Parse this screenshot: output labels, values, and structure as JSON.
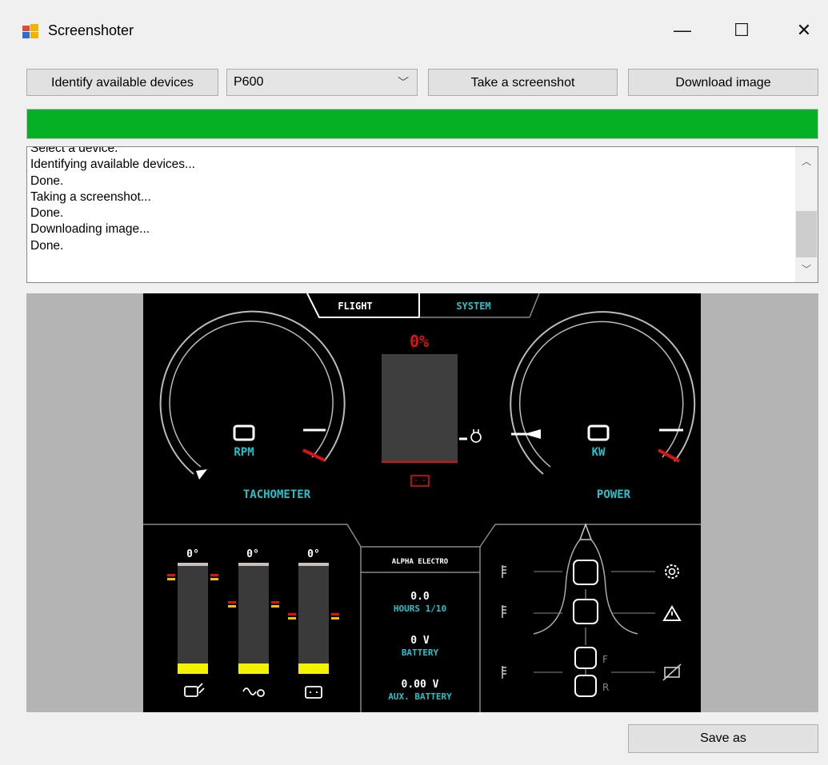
{
  "window": {
    "title": "Screenshoter",
    "minimize_glyph": "—",
    "maximize_glyph": "☐",
    "close_glyph": "✕"
  },
  "toolbar": {
    "identify_label": "Identify available devices",
    "device_selected": "P600",
    "screenshot_label": "Take a screenshot",
    "download_label": "Download image"
  },
  "progress": {
    "percent": 100,
    "color": "#06b025"
  },
  "log": {
    "lines": [
      "Select a device.",
      "Identifying available devices...",
      "Done.",
      "Taking a screenshot...",
      "Done.",
      "Downloading image...",
      "Done."
    ]
  },
  "device": {
    "tabs": {
      "flight": "FLIGHT",
      "system": "SYSTEM"
    },
    "battery_percent": "0%",
    "tachometer": {
      "value": "0",
      "unit": "RPM",
      "label": "TACHOMETER"
    },
    "power": {
      "value": "0",
      "unit": "KW",
      "label": "POWER"
    },
    "brand": "ALPHA ELECTRO",
    "hours": {
      "value": "0.0",
      "label": "HOURS 1/10"
    },
    "battery": {
      "value": "0 V",
      "label": "BATTERY"
    },
    "aux_battery": {
      "value": "0.00 V",
      "label": "AUX. BATTERY"
    },
    "temp_labels": [
      "0°",
      "0°",
      "0°"
    ],
    "side_letters": [
      "F",
      "R"
    ],
    "accent_color": "#26c1c9",
    "warn_color": "#e01010",
    "level_color": "#f3f300"
  },
  "footer": {
    "save_label": "Save as"
  }
}
